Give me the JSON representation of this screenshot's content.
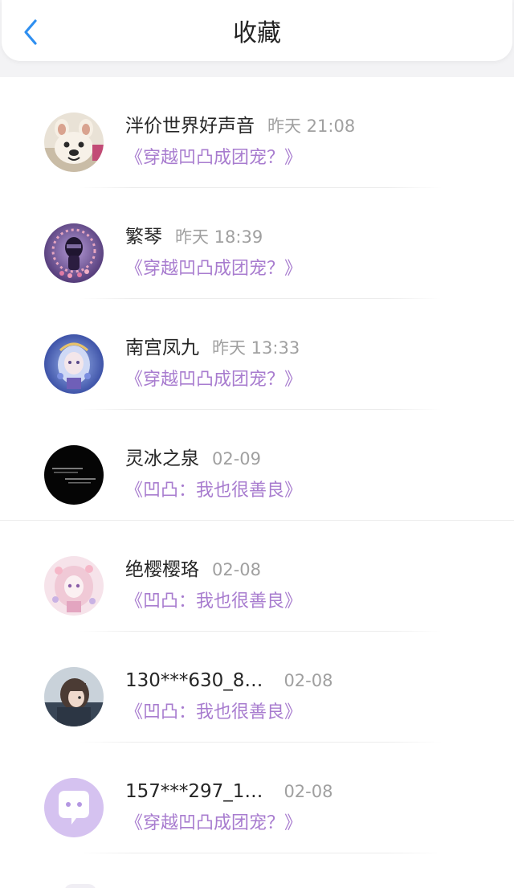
{
  "header": {
    "title": "收藏"
  },
  "colors": {
    "accent": "#a87ccf",
    "back_icon": "#2f8ff0"
  },
  "items": [
    {
      "name": "泮价世界好声音",
      "time": "昨天 21:08",
      "book": "《穿越凹凸成团宠？》",
      "avatar_icon": "bulldog-avatar-icon"
    },
    {
      "name": "繁琴",
      "time": "昨天 18:39",
      "book": "《穿越凹凸成团宠？》",
      "avatar_icon": "purple-portrait-avatar-icon"
    },
    {
      "name": "南宫凤九",
      "time": "昨天 13:33",
      "book": "《穿越凹凸成团宠？》",
      "avatar_icon": "anime-blue-avatar-icon"
    },
    {
      "name": "灵冰之泉",
      "time": "02-09",
      "book": "《凹凸：我也很善良》",
      "avatar_icon": "black-text-avatar-icon"
    },
    {
      "name": "绝樱樱珞",
      "time": "02-08",
      "book": "《凹凸：我也很善良》",
      "avatar_icon": "anime-pink-avatar-icon"
    },
    {
      "name": "130***630_8…",
      "time": "02-08",
      "book": "《凹凸：我也很善良》",
      "avatar_icon": "anime-dark-avatar-icon"
    },
    {
      "name": "157***297_1…",
      "time": "02-08",
      "book": "《穿越凹凸成团宠？》",
      "avatar_icon": "default-chat-avatar-icon"
    }
  ]
}
